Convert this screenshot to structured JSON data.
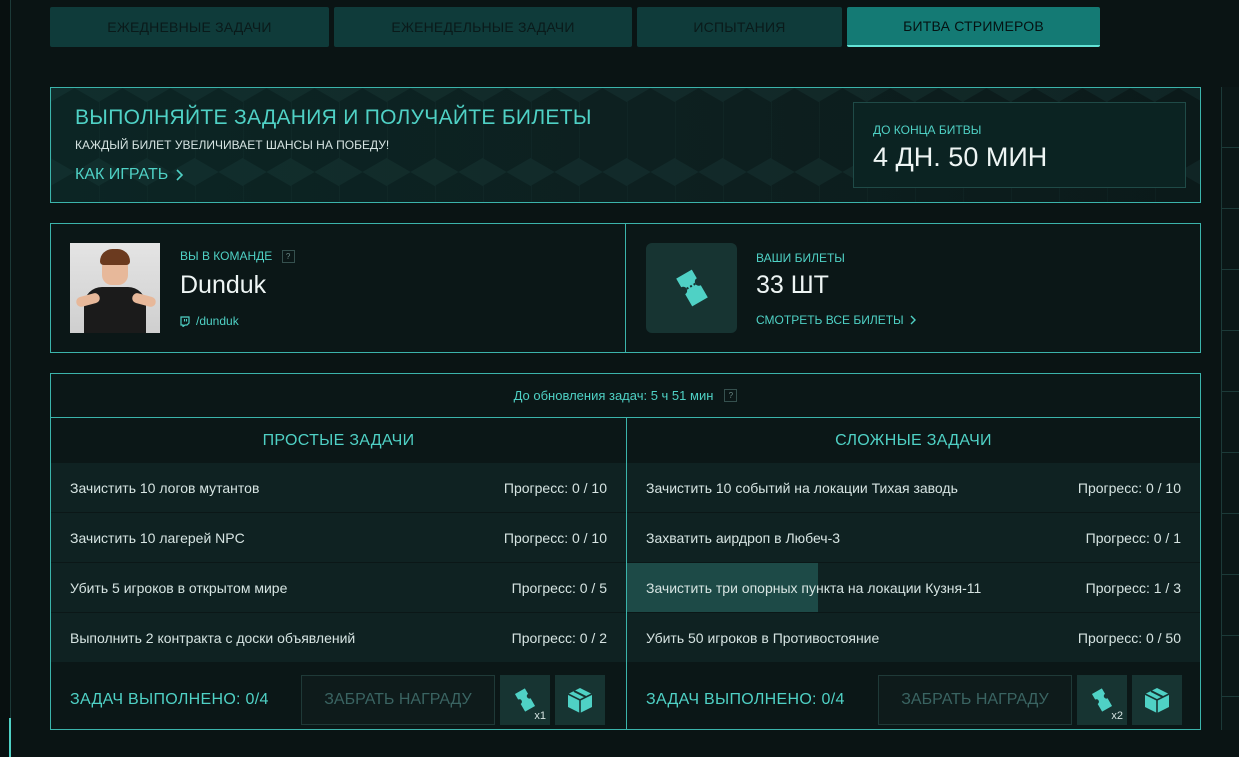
{
  "tabs": [
    {
      "label": "ЕЖЕДНЕВНЫЕ ЗАДАЧИ",
      "active": false
    },
    {
      "label": "ЕЖЕНЕДЕЛЬНЫЕ ЗАДАЧИ",
      "active": false
    },
    {
      "label": "ИСПЫТАНИЯ",
      "active": false
    },
    {
      "label": "БИТВА СТРИМЕРОВ",
      "active": true
    }
  ],
  "banner": {
    "title": "ВЫПОЛНЯЙТЕ ЗАДАНИЯ И ПОЛУЧАЙТЕ БИЛЕТЫ",
    "subtitle": "КАЖДЫЙ БИЛЕТ УВЕЛИЧИВАЕТ ШАНСЫ НА ПОБЕДУ!",
    "how_to_play": "КАК ИГРАТЬ",
    "timer_label": "ДО КОНЦА БИТВЫ",
    "timer_value": "4 ДН. 50 МИН"
  },
  "team": {
    "label": "ВЫ В КОМАНДЕ",
    "help": "?",
    "streamer": "Dunduk",
    "twitch_handle": "/dunduk"
  },
  "tickets": {
    "label": "ВАШИ БИЛЕТЫ",
    "value": "33 ШТ",
    "view_all": "СМОТРЕТЬ ВСЕ БИЛЕТЫ"
  },
  "tasks": {
    "refresh_text": "До обновления задач: 5 ч 51 мин",
    "help": "?",
    "simple": {
      "title": "ПРОСТЫЕ ЗАДАЧИ",
      "items": [
        {
          "name": "Зачистить 10 логов мутантов",
          "progress": "Прогресс: 0 / 10",
          "fraction": 0
        },
        {
          "name": "Зачистить 10 лагерей NPC",
          "progress": "Прогресс: 0 / 10",
          "fraction": 0
        },
        {
          "name": "Убить 5 игроков в открытом мире",
          "progress": "Прогресс: 0 / 5",
          "fraction": 0
        },
        {
          "name": "Выполнить 2 контракта с доски объявлений",
          "progress": "Прогресс: 0 / 2",
          "fraction": 0
        }
      ],
      "done": "ЗАДАЧ ВЫПОЛНЕНО: 0/4",
      "claim": "ЗАБРАТЬ НАГРАДУ",
      "ticket_mult": "x1"
    },
    "hard": {
      "title": "СЛОЖНЫЕ ЗАДАЧИ",
      "items": [
        {
          "name": "Зачистить 10 событий на локации Тихая заводь",
          "progress": "Прогресс: 0 / 10",
          "fraction": 0
        },
        {
          "name": "Захватить аирдроп в Любеч-3",
          "progress": "Прогресс: 0 / 1",
          "fraction": 0
        },
        {
          "name": "Зачистить три опорных пункта на локации Кузня-11",
          "progress": "Прогресс: 1 / 3",
          "fraction": 0.3333
        },
        {
          "name": "Убить 50 игроков в Противостояние",
          "progress": "Прогресс: 0 / 50",
          "fraction": 0
        }
      ],
      "done": "ЗАДАЧ ВЫПОЛНЕНО: 0/4",
      "claim": "ЗАБРАТЬ НАГРАДУ",
      "ticket_mult": "x2"
    }
  },
  "colors": {
    "accent": "#4fd1c5",
    "tab_active": "#147a74",
    "tab": "#0f3b3a",
    "border": "#3bb4ab"
  },
  "icons": [
    "chevron-right-icon",
    "twitch-icon",
    "ticket-icon",
    "crate-icon"
  ]
}
